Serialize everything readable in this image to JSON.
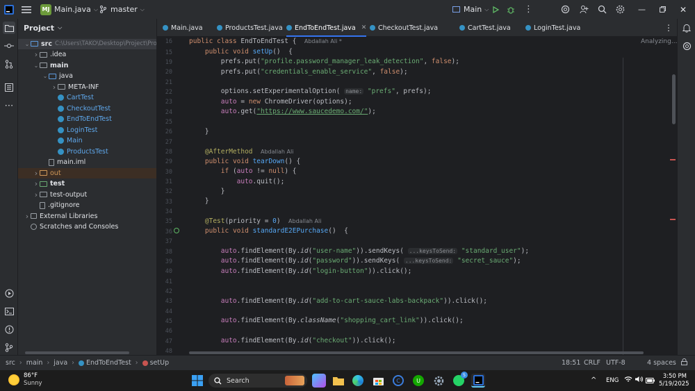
{
  "titlebar": {
    "project_badge": "MJ",
    "project_name": "Main.java",
    "branch": "master",
    "run_config": "Main"
  },
  "project_panel": {
    "title": "Project",
    "tree": [
      {
        "label": "src",
        "path": "C:\\Users\\TAKO\\Desktop\\Project\\Pro",
        "kind": "folder",
        "depth": 0,
        "expanded": true
      },
      {
        "label": ".idea",
        "kind": "folder",
        "depth": 1,
        "expanded": false
      },
      {
        "label": "main",
        "kind": "folder",
        "depth": 1,
        "expanded": true
      },
      {
        "label": "java",
        "kind": "folder",
        "depth": 2,
        "expanded": true
      },
      {
        "label": "META-INF",
        "kind": "folder",
        "depth": 3,
        "expanded": false
      },
      {
        "label": "CartTest",
        "kind": "class",
        "depth": 3
      },
      {
        "label": "CheckoutTest",
        "kind": "class",
        "depth": 3
      },
      {
        "label": "EndToEndTest",
        "kind": "class",
        "depth": 3
      },
      {
        "label": "LoginTest",
        "kind": "class",
        "depth": 3
      },
      {
        "label": "Main",
        "kind": "class",
        "depth": 3
      },
      {
        "label": "ProductsTest",
        "kind": "class",
        "depth": 3
      },
      {
        "label": "main.iml",
        "kind": "file",
        "depth": 2
      },
      {
        "label": "out",
        "kind": "folder-excluded",
        "depth": 1,
        "expanded": false
      },
      {
        "label": "test",
        "kind": "folder",
        "depth": 1,
        "expanded": false
      },
      {
        "label": "test-output",
        "kind": "folder",
        "depth": 1,
        "expanded": false
      },
      {
        "label": ".gitignore",
        "kind": "file",
        "depth": 1
      },
      {
        "label": "External Libraries",
        "kind": "library",
        "depth": 0,
        "expanded": false
      },
      {
        "label": "Scratches and Consoles",
        "kind": "scratch",
        "depth": 0
      }
    ]
  },
  "tabs": [
    {
      "label": "Main.java",
      "active": false
    },
    {
      "label": "ProductsTest.java",
      "active": false
    },
    {
      "label": "EndToEndTest.java",
      "active": true
    },
    {
      "label": "CheckoutTest.java",
      "active": false
    },
    {
      "label": "CartTest.java",
      "active": false
    },
    {
      "label": "LoginTest.java",
      "active": false
    }
  ],
  "editor": {
    "analyzing": "Analyzing...",
    "sticky_line": "16",
    "sticky_code": "public class EndToEndTest {",
    "sticky_author": "Abdallah Ali *",
    "lines": [
      {
        "n": "15",
        "code": "    public void setUp()  {"
      },
      {
        "n": "19",
        "code": "        prefs.put(\"profile.password_manager_leak_detection\", false);"
      },
      {
        "n": "20",
        "code": "        prefs.put(\"credentials_enable_service\", false);"
      },
      {
        "n": "21",
        "code": ""
      },
      {
        "n": "22",
        "code": "        options.setExperimentalOption( name: \"prefs\", prefs);"
      },
      {
        "n": "23",
        "code": "        auto = new ChromeDriver(options);"
      },
      {
        "n": "24",
        "code": "        auto.get(\"https://www.saucedemo.com/\");"
      },
      {
        "n": "25",
        "code": ""
      },
      {
        "n": "26",
        "code": "    }"
      },
      {
        "n": "27",
        "code": ""
      },
      {
        "n": "28",
        "code": "    @AfterMethod"
      },
      {
        "n": "29",
        "code": "    public void tearDown() {"
      },
      {
        "n": "30",
        "code": "        if (auto != null) {"
      },
      {
        "n": "31",
        "code": "            auto.quit();"
      },
      {
        "n": "32",
        "code": "        }"
      },
      {
        "n": "33",
        "code": "    }"
      },
      {
        "n": "34",
        "code": ""
      },
      {
        "n": "35",
        "code": "    @Test(priority = 0)"
      },
      {
        "n": "36",
        "code": "    public void standardE2EPurchase()  {"
      },
      {
        "n": "37",
        "code": ""
      },
      {
        "n": "38",
        "code": "        auto.findElement(By.id(\"user-name\")).sendKeys( ...keysToSend: \"standard_user\");"
      },
      {
        "n": "39",
        "code": "        auto.findElement(By.id(\"password\")).sendKeys( ...keysToSend: \"secret_sauce\");"
      },
      {
        "n": "40",
        "code": "        auto.findElement(By.id(\"login-button\")).click();"
      },
      {
        "n": "41",
        "code": ""
      },
      {
        "n": "42",
        "code": ""
      },
      {
        "n": "43",
        "code": "        auto.findElement(By.id(\"add-to-cart-sauce-labs-backpack\")).click();"
      },
      {
        "n": "44",
        "code": ""
      },
      {
        "n": "45",
        "code": "        auto.findElement(By.className(\"shopping_cart_link\")).click();"
      },
      {
        "n": "46",
        "code": ""
      },
      {
        "n": "47",
        "code": "        auto.findElement(By.id(\"checkout\")).click();"
      },
      {
        "n": "48",
        "code": ""
      }
    ],
    "author_labels": {
      "after": "Abdallah Ali",
      "test": "Abdallah Ali"
    },
    "hints": {
      "name": "name:",
      "keys": "...keysToSend:"
    }
  },
  "statusbar": {
    "breadcrumb": [
      "src",
      "main",
      "java",
      "EndToEndTest",
      "setUp"
    ],
    "position": "18:51",
    "line_sep": "CRLF",
    "encoding": "UTF-8",
    "indent": "4 spaces"
  },
  "taskbar": {
    "weather_temp": "86°F",
    "weather_desc": "Sunny",
    "search": "Search",
    "lang": "ENG",
    "time": "3:50 PM",
    "date": "5/19/2025",
    "badge": "5"
  },
  "colors": {
    "accent": "#3574f0",
    "keyword": "#cf8e6d",
    "string": "#6aab73",
    "function": "#56a8f5",
    "annotation": "#b3ae60"
  }
}
